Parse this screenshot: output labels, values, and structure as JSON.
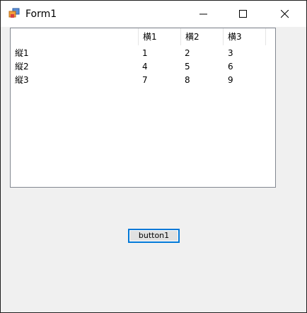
{
  "window": {
    "title": "Form1",
    "icon": "form-app-icon",
    "controls": [
      "minimize-icon",
      "maximize-icon",
      "close-icon"
    ]
  },
  "listview": {
    "columns": [
      "",
      "横1",
      "横2",
      "横3"
    ],
    "rows": [
      [
        "縦1",
        "1",
        "2",
        "3"
      ],
      [
        "縦2",
        "4",
        "5",
        "6"
      ],
      [
        "縦3",
        "7",
        "8",
        "9"
      ]
    ]
  },
  "button1": {
    "label": "button1"
  },
  "colors": {
    "button_focus_border": "#0078d7",
    "client_background": "#f0f0f0",
    "titlebar_background": "#ffffff"
  }
}
